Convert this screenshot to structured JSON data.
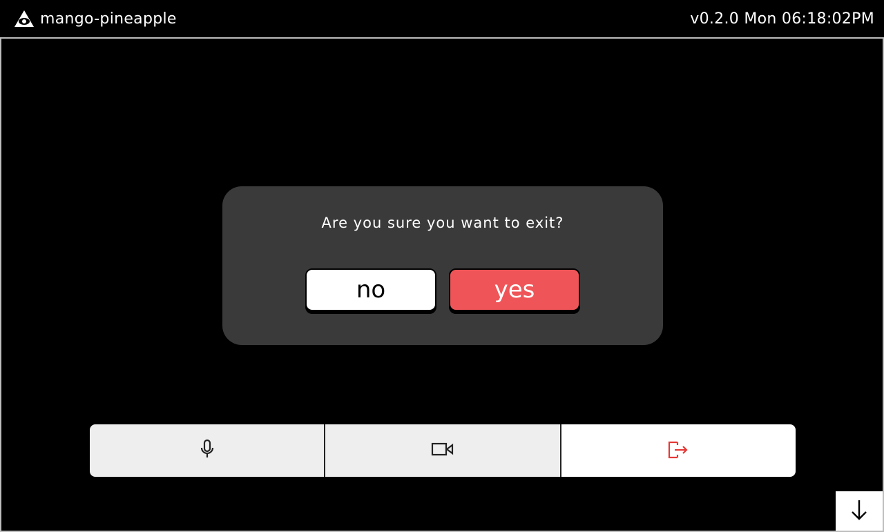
{
  "topbar": {
    "app_name": "mango-pineapple",
    "logo_icon": "triangle-eye-logo-icon",
    "version": "v0.2.0",
    "day": "Mon",
    "time": "06:18:02PM",
    "status_text": "v0.2.0 Mon 06:18:02PM"
  },
  "dialog": {
    "message": "Are you sure you want to exit?",
    "no_label": "no",
    "yes_label": "yes"
  },
  "controls": {
    "mic_icon": "microphone-icon",
    "camera_icon": "video-camera-icon",
    "exit_icon": "exit-door-icon"
  },
  "scroll_icon": "arrow-down-icon",
  "colors": {
    "background": "#000000",
    "dialog": "#3a3a3a",
    "danger": "#ef5558",
    "control_bg": "#eeeeee",
    "exit_icon": "#e53935"
  }
}
